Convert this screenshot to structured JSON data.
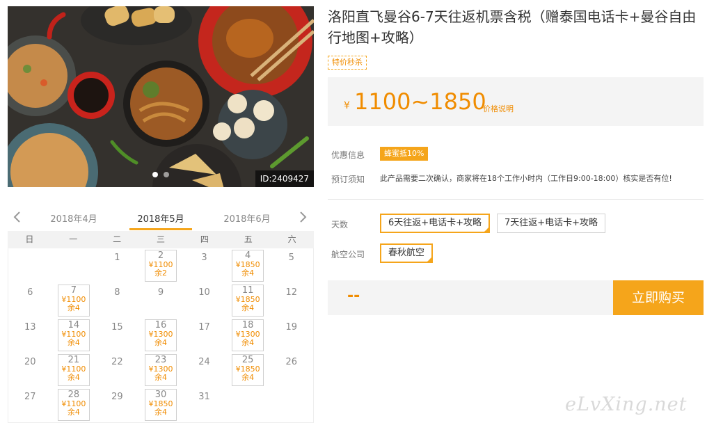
{
  "product": {
    "title": "洛阳直飞曼谷6-7天往返机票含税（赠泰国电话卡+曼谷自由行地图+攻略）",
    "image_id": "ID:2409427",
    "flash_tag": "特价秒杀",
    "image_slides": 2,
    "image_active_slide": 1
  },
  "price": {
    "currency": "¥",
    "range": "1100~1850",
    "note": "价格说明"
  },
  "info": {
    "discount_label": "优惠信息",
    "discount_badge": "蜂蜜抵10%",
    "notice_label": "预订须知",
    "notice_text": "此产品需要二次确认，商家将在18个工作小时内（工作日9:00-18:00）核实是否有位!"
  },
  "options": {
    "days_label": "天数",
    "days": [
      "6天往返+电话卡+攻略",
      "7天往返+电话卡+攻略"
    ],
    "days_selected": 0,
    "airline_label": "航空公司",
    "airlines": [
      "春秋航空"
    ],
    "airline_selected": 0
  },
  "purchase": {
    "total": "--",
    "buy_label": "立即购买"
  },
  "calendar": {
    "months": [
      "2018年4月",
      "2018年5月",
      "2018年6月"
    ],
    "current_month": "2018年5月",
    "weekdays": [
      "日",
      "一",
      "二",
      "三",
      "四",
      "五",
      "六"
    ],
    "first_weekday": 2,
    "days_in_month": 31,
    "available": {
      "2": {
        "price": "¥1100",
        "stock": "余2"
      },
      "4": {
        "price": "¥1850",
        "stock": "余4"
      },
      "7": {
        "price": "¥1100",
        "stock": "余4"
      },
      "11": {
        "price": "¥1850",
        "stock": "余4"
      },
      "14": {
        "price": "¥1100",
        "stock": "余4"
      },
      "16": {
        "price": "¥1300",
        "stock": "余4"
      },
      "18": {
        "price": "¥1300",
        "stock": "余4"
      },
      "21": {
        "price": "¥1100",
        "stock": "余4"
      },
      "23": {
        "price": "¥1300",
        "stock": "余4"
      },
      "25": {
        "price": "¥1850",
        "stock": "余4"
      },
      "28": {
        "price": "¥1100",
        "stock": "余4"
      },
      "30": {
        "price": "¥1850",
        "stock": "余4"
      }
    }
  },
  "watermark": "eLvXing.net",
  "colors": {
    "accent": "#f5a51b",
    "price": "#f08c00",
    "panel_bg": "#f4f4f4"
  }
}
